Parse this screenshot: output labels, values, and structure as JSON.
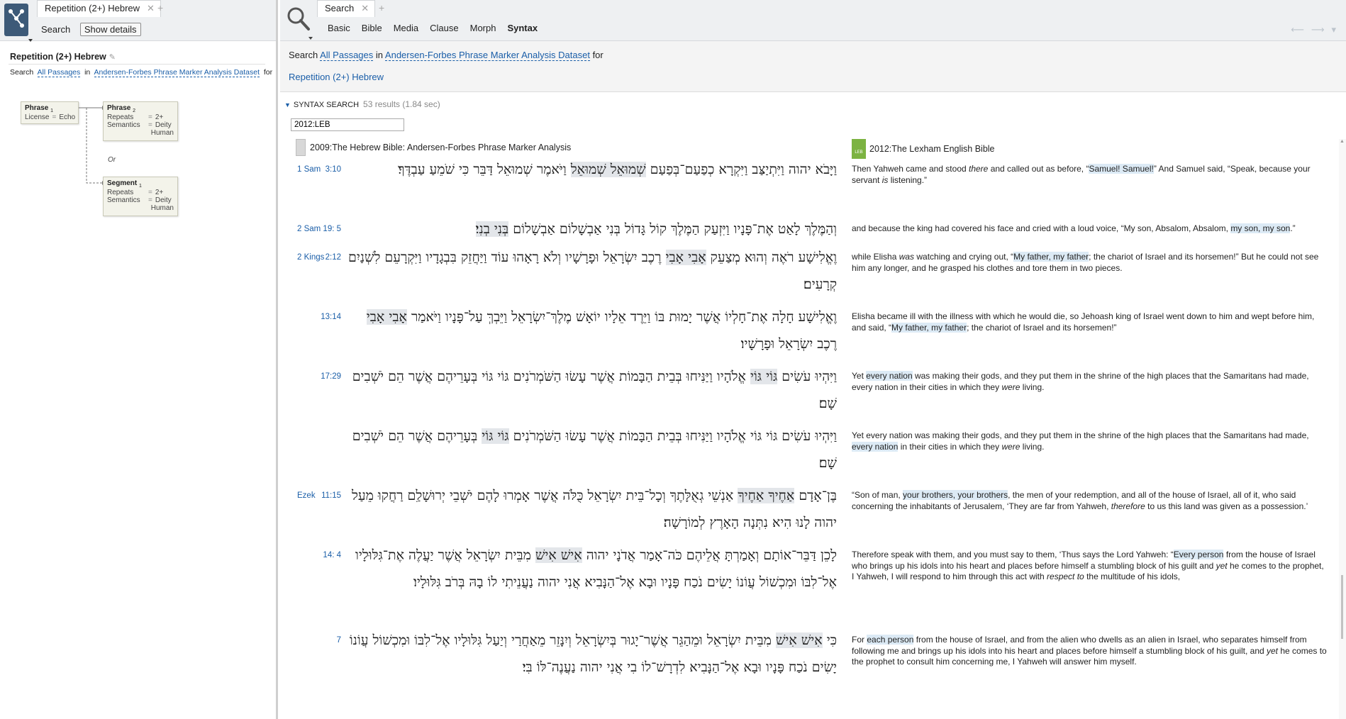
{
  "left": {
    "tab_label": "Repetition (2+) Hebrew",
    "tab_add": "+",
    "search_link": "Search",
    "show_details": "Show details",
    "title": "Repetition (2+) Hebrew",
    "search_prefix": "Search",
    "search_passages": "All Passages",
    "search_in": "in",
    "search_dataset": "Andersen-Forbes Phrase Marker Analysis Dataset",
    "search_for": "for",
    "nodes": {
      "phrase1": {
        "title": "Phrase",
        "sub": "1",
        "rows": [
          {
            "k": "License",
            "v": "Echo"
          }
        ]
      },
      "phrase2": {
        "title": "Phrase",
        "sub": "2",
        "rows": [
          {
            "k": "Repeats",
            "v": "2+"
          },
          {
            "k": "Semantics",
            "v": "Deity"
          },
          {
            "k": "",
            "v": "Human"
          }
        ]
      },
      "segment1": {
        "title": "Segment",
        "sub": "1",
        "rows": [
          {
            "k": "Repeats",
            "v": "2+"
          },
          {
            "k": "Semantics",
            "v": "Deity"
          },
          {
            "k": "",
            "v": "Human"
          }
        ]
      }
    },
    "or_label": "Or"
  },
  "right": {
    "tab_label": "Search",
    "tab_add": "+",
    "nav_tabs": [
      "Basic",
      "Bible",
      "Media",
      "Clause",
      "Morph",
      "Syntax"
    ],
    "active_tab": "Syntax",
    "query": {
      "prefix": "Search",
      "passages": "All Passages",
      "in": "in",
      "dataset": "Andersen-Forbes Phrase Marker Analysis Dataset",
      "for": "for",
      "query_name": "Repetition (2+) Hebrew"
    },
    "results": {
      "section_label": "SYNTAX SEARCH",
      "count": "53 results (1.84 sec)",
      "filter_value": "2012:LEB"
    },
    "columns": {
      "left": "2009:The Hebrew Bible: Andersen-Forbes Phrase Marker Analysis",
      "right": "2012:The Lexham English Bible",
      "right_badge": "LEB"
    },
    "rows": [
      {
        "book": "1 Sam",
        "verse": "3:10",
        "heb": [
          {
            "t": "וַיָּבֹא יהוה וַיִּתְיַצַּב וַיִּקְרָא כְפַעַם־בְּפַעַם "
          },
          {
            "t": "שְׁמוּאֵל שְׁמוּאֵל",
            "hl": true
          },
          {
            "t": " וַיֹּאמֶר שְׁמוּאֵל דַּבֵּר כִּי שֹׁמֵעַ עַבְדֶּךָ׃"
          }
        ],
        "eng": [
          {
            "t": "Then Yahweh came and stood "
          },
          {
            "t": "there",
            "em": true
          },
          {
            "t": " and called out as before, “"
          },
          {
            "t": "Samuel! Samuel!",
            "hl": true
          },
          {
            "t": "” And Samuel said, “Speak, because your servant "
          },
          {
            "t": "is",
            "em": true
          },
          {
            "t": " listening.”"
          }
        ]
      },
      {
        "book": "2 Sam",
        "verse": "19:  5",
        "heb": [
          {
            "t": "וְהַמֶּלֶךְ לָאַט אֶת־פָּנָיו וַיִּזְעַק הַמֶּלֶךְ קוֹל גָּדוֹל בְּנִי אַבְשָׁלוֹם אַבְשָׁלוֹם "
          },
          {
            "t": "בְּנִי בְנִי׃",
            "hl": true
          }
        ],
        "eng": [
          {
            "t": "and because the king had covered his face and cried with a loud voice, “My son, Absalom, Absalom, "
          },
          {
            "t": "my son, my son",
            "hl": true
          },
          {
            "t": ".”"
          }
        ]
      },
      {
        "book": "2 Kings",
        "verse": "2:12",
        "heb": [
          {
            "t": "וֶאֱלִישָׁע רֹאֶה וְהוּא מְצַעֵק "
          },
          {
            "t": "אָבִי אָבִי",
            "hl": true
          },
          {
            "t": " רֶכֶב יִשְׂרָאֵל וּפָרָשָׁיו וְלֹא רָאָהוּ עוֹד וַיַּחֲזֵק בִּבְגָדָיו וַיִּקְרָעֵם לִשְׁנַיִם קְרָעִים׃"
          }
        ],
        "eng": [
          {
            "t": "while Elisha "
          },
          {
            "t": "was",
            "em": true
          },
          {
            "t": " watching and crying out, “"
          },
          {
            "t": "My father, my father",
            "hl": true
          },
          {
            "t": "; the chariot of Israel and its horsemen!” But he could not see him any longer, and he grasped his clothes and tore them in two pieces."
          }
        ]
      },
      {
        "book": "",
        "verse": "13:14",
        "heb": [
          {
            "t": "וֶאֱלִישָׁע חָלָה אֶת־חָלְיוֹ אֲשֶׁר יָמוּת בּוֹ וַיֵּרֶד אֵלָיו יוֹאָשׁ מֶלֶךְ־יִשְׂרָאֵל וַיֵּבְךְּ עַל־פָּנָיו וַיֹּאמַר "
          },
          {
            "t": "אָבִי אָבִי",
            "hl": true
          },
          {
            "t": " רֶכֶב יִשְׂרָאֵל וּפָרָשָׁיו׃"
          }
        ],
        "eng": [
          {
            "t": "Elisha became ill with the illness with which he would die, so Jehoash king of Israel went down to him and wept before him, and said, “"
          },
          {
            "t": "My father, my father",
            "hl": true
          },
          {
            "t": "; the chariot of Israel and its horsemen!”"
          }
        ]
      },
      {
        "book": "",
        "verse": "17:29",
        "heb": [
          {
            "t": "וַיִּהְיוּ עֹשִׂים "
          },
          {
            "t": "גּוֹי גּוֹי",
            "hl": true
          },
          {
            "t": " אֱלֹהָיו וַיַּנִּיחוּ בְּבֵית הַבָּמוֹת אֲשֶׁר עָשׂוּ הַשֹּׁמְרֹנִים גּוֹי גּוֹי בְּעָרֵיהֶם אֲשֶׁר הֵם יֹשְׁבִים שָׁם׃"
          }
        ],
        "eng": [
          {
            "t": "Yet "
          },
          {
            "t": "every nation",
            "hl": true
          },
          {
            "t": " was making their gods, and they put them in the shrine of the high places that the Samaritans had made, every nation in their cities in which they "
          },
          {
            "t": "were",
            "em": true
          },
          {
            "t": " living."
          }
        ]
      },
      {
        "book": "",
        "verse": "",
        "heb": [
          {
            "t": "וַיִּהְיוּ עֹשִׂים גּוֹי גּוֹי אֱלֹהָיו וַיַּנִּיחוּ בְּבֵית הַבָּמוֹת אֲשֶׁר עָשׂוּ הַשֹּׁמְרֹנִים "
          },
          {
            "t": "גּוֹי גּוֹי",
            "hl": true
          },
          {
            "t": " בְּעָרֵיהֶם אֲשֶׁר הֵם יֹשְׁבִים שָׁם׃"
          }
        ],
        "eng": [
          {
            "t": "Yet every nation was making their gods, and they put them in the shrine of the high places that the Samaritans had made, "
          },
          {
            "t": "every nation",
            "hl": true
          },
          {
            "t": " in their cities in which they "
          },
          {
            "t": "were",
            "em": true
          },
          {
            "t": " living."
          }
        ]
      },
      {
        "book": "Ezek",
        "verse": "11:15",
        "heb": [
          {
            "t": "בֶּן־אָדָם "
          },
          {
            "t": "אַחֶיךָ אַחֶיךָ",
            "hl": true
          },
          {
            "t": " אַנְשֵׁי גְאֻלָּתֶךָ וְכָל־בֵּית יִשְׂרָאֵל כֻּלֹּה אֲשֶׁר אָמְרוּ לָהֶם יֹשְׁבֵי יְרוּשָׁלִַם רַחֲקוּ מֵעַל יהוה לָנוּ הִיא נִתְּנָה הָאָרֶץ לְמוֹרָשָׁה׃"
          }
        ],
        "eng": [
          {
            "t": "“Son of man, "
          },
          {
            "t": "your brothers, your brothers",
            "hl": true
          },
          {
            "t": ", the men of your redemption, and all of the house of Israel, all of it, who said concerning the inhabitants of Jerusalem, ‘They are far from Yahweh, "
          },
          {
            "t": "therefore",
            "em": true
          },
          {
            "t": " to us this land was given as a possession.’"
          }
        ]
      },
      {
        "book": "",
        "verse": "14:  4",
        "heb": [
          {
            "t": "לָכֵן דַּבֵּר־אוֹתָם וְאָמַרְתָּ אֲלֵיהֶם כֹּה־אָמַר אֲדֹנָי יהוה "
          },
          {
            "t": "אִישׁ אִישׁ",
            "hl": true
          },
          {
            "t": " מִבֵּית יִשְׂרָאֵל אֲשֶׁר יַעֲלֶה אֶת־גִּלּוּלָיו אֶל־לִבּוֹ וּמִכְשׁוֹל עֲוֹנוֹ יָשִׂים נֹכַח פָּנָיו וּבָא אֶל־הַנָּבִיא אֲנִי יהוה נַעֲנֵיתִי לוֹ בָהּ בְּרֹב גִּלּוּלָיו׃"
          }
        ],
        "eng": [
          {
            "t": "Therefore speak with them, and you must say to them, ‘Thus says the Lord Yahweh: “"
          },
          {
            "t": "Every person",
            "hl": true
          },
          {
            "t": " from the house of Israel who brings up his idols into his heart and places before himself a stumbling block of his guilt and "
          },
          {
            "t": "yet",
            "em": true
          },
          {
            "t": " he comes to the prophet, I Yahweh, I will respond to him through this act with "
          },
          {
            "t": "respect to",
            "em": true
          },
          {
            "t": " the multitude of his idols,"
          }
        ]
      },
      {
        "book": "",
        "verse": "7",
        "heb": [
          {
            "t": "כִּי "
          },
          {
            "t": "אִישׁ אִישׁ",
            "hl": true
          },
          {
            "t": " מִבֵּית יִשְׂרָאֵל וּמֵהַגֵּר אֲשֶׁר־יָגוּר בְּיִשְׂרָאֵל וְיִנָּזֵר מֵאַחֲרַי וְיַעַל גִּלּוּלָיו אֶל־לִבּוֹ וּמִכְשׁוֹל עֲוֹנוֹ יָשִׂים נֹכַח פָּנָיו וּבָא אֶל־הַנָּבִיא לִדְרָשׁ־לוֹ בִי אֲנִי יהוה נַעֲנֶה־לּוֹ בִּי׃"
          }
        ],
        "eng": [
          {
            "t": "For "
          },
          {
            "t": "each person",
            "hl": true
          },
          {
            "t": " from the house of Israel, and from the alien who dwells as an alien in Israel, who separates himself from following me and brings up his idols into his heart and places before himself a stumbling block of his guilt, and "
          },
          {
            "t": "yet",
            "em": true
          },
          {
            "t": " he comes to the prophet to consult him concerning me, I Yahweh will answer him myself."
          }
        ]
      }
    ]
  }
}
